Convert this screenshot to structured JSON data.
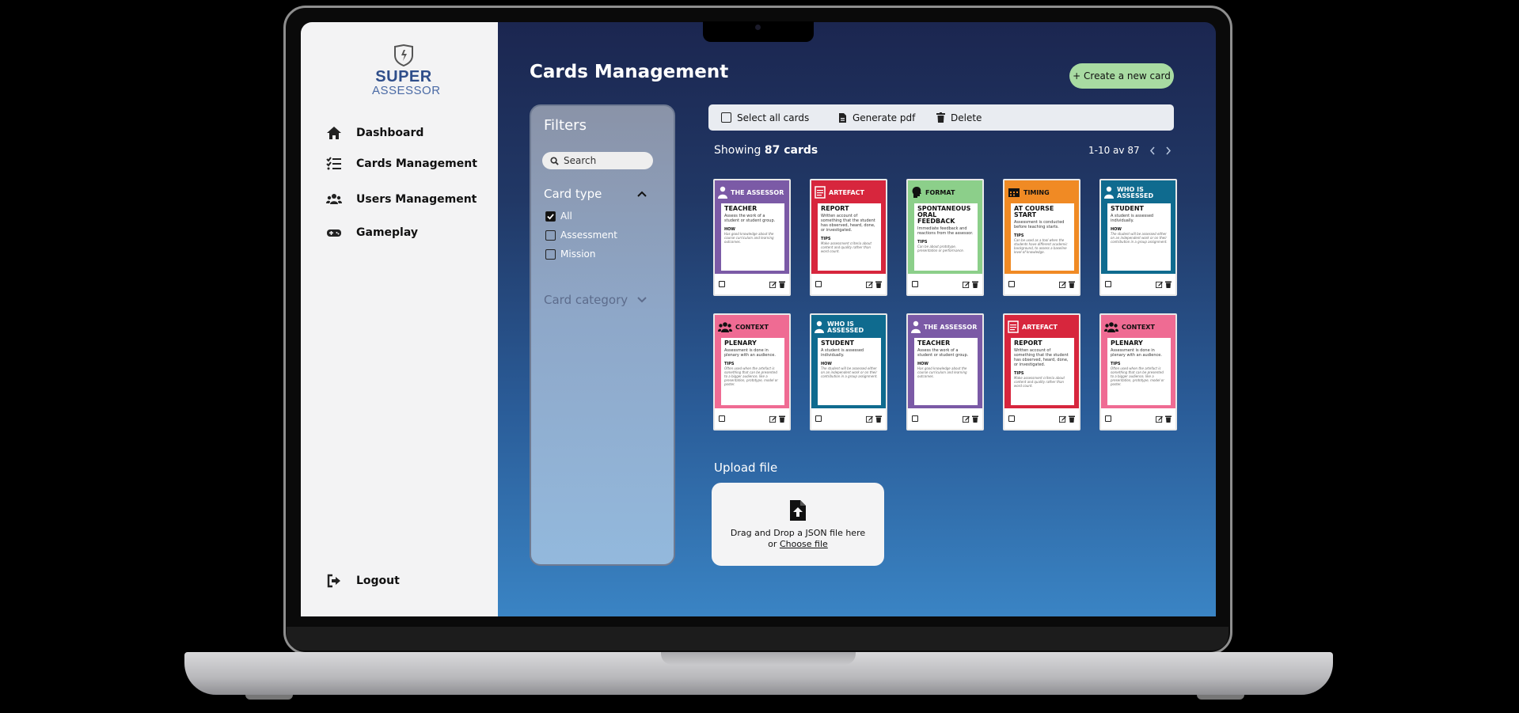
{
  "logo": {
    "word1": "SUPER",
    "word2": "ASSESSOR"
  },
  "sidebar": {
    "items": [
      {
        "label": "Dashboard",
        "icon": "home-icon"
      },
      {
        "label": "Cards Management",
        "icon": "checklist-icon"
      },
      {
        "label": "Users Management",
        "icon": "users-icon"
      },
      {
        "label": "Gameplay",
        "icon": "gamepad-icon"
      }
    ],
    "logout": "Logout"
  },
  "header": {
    "title": "Cards Management",
    "create_label": "+ Create a new card"
  },
  "filters": {
    "title": "Filters",
    "search_placeholder": "Search",
    "card_type": {
      "label": "Card type",
      "options": [
        {
          "label": "All",
          "checked": true
        },
        {
          "label": "Assessment",
          "checked": false
        },
        {
          "label": "Mission",
          "checked": false
        }
      ]
    },
    "card_category": {
      "label": "Card category"
    }
  },
  "toolbar": {
    "select_all": "Select all cards",
    "generate_pdf": "Generate pdf",
    "delete": "Delete"
  },
  "summary": {
    "prefix": "Showing",
    "count": "87 cards",
    "range": "1-10 av 87"
  },
  "cards": [
    {
      "category": "THE ASSESSOR",
      "title": "TEACHER",
      "desc": "Assess the work of a student or student group.",
      "label": "HOW",
      "note": "Has good knowledge about the course curriculum and learning outcomes.",
      "color": "#7b5aa6",
      "icon": "person-icon"
    },
    {
      "category": "ARTEFACT",
      "title": "REPORT",
      "desc": "Written account of something that the student has observed, heard, done, or investigated.",
      "label": "TIPS",
      "note": "Make assessment criteria about content and quality rather than word count.",
      "color": "#d7263d",
      "icon": "document-icon"
    },
    {
      "category": "FORMAT",
      "title": "SPONTANEOUS ORAL FEEDBACK",
      "desc": "Immediate feedback and reactions from the assessor.",
      "label": "TIPS",
      "note": "Can be about prototype, presentation or performance.",
      "color": "#8ccf8a",
      "icon": "speech-head-icon"
    },
    {
      "category": "TIMING",
      "title": "AT COURSE START",
      "desc": "Assessment is conducted before teaching starts.",
      "label": "TIPS",
      "note": "Can be used as a tool when the students have different academic background, to assess a baseline level of knowledge.",
      "color": "#f08a24",
      "icon": "calendar-icon"
    },
    {
      "category": "WHO IS ASSESSED",
      "title": "STUDENT",
      "desc": "A student is assessed individually.",
      "label": "HOW",
      "note": "The student will be assessed either on an independent work or on their contribution in a group assignment.",
      "color": "#0f6b8f",
      "icon": "person-icon"
    },
    {
      "category": "CONTEXT",
      "title": "PLENARY",
      "desc": "Assessment is done in plenary with an audience.",
      "label": "TIPS",
      "note": "Often used when the artefact is something that can be presented to a bigger audience, like a presentation, prototype, model or poster.",
      "color": "#ef6b93",
      "icon": "group-icon"
    },
    {
      "category": "WHO IS ASSESSED",
      "title": "STUDENT",
      "desc": "A student is assessed individually.",
      "label": "HOW",
      "note": "The student will be assessed either on an independent work or on their contribution in a group assignment.",
      "color": "#0f6b8f",
      "icon": "person-icon"
    },
    {
      "category": "THE ASSESSOR",
      "title": "TEACHER",
      "desc": "Assess the work of a student or student group.",
      "label": "HOW",
      "note": "Has good knowledge about the course curriculum and learning outcomes.",
      "color": "#7b5aa6",
      "icon": "person-icon"
    },
    {
      "category": "ARTEFACT",
      "title": "REPORT",
      "desc": "Written account of something that the student has observed, heard, done, or investigated.",
      "label": "TIPS",
      "note": "Make assessment criteria about content and quality rather than word count.",
      "color": "#d7263d",
      "icon": "document-icon"
    },
    {
      "category": "CONTEXT",
      "title": "PLENARY",
      "desc": "Assessment is done in plenary with an audience.",
      "label": "TIPS",
      "note": "Often used when the artefact is something that can be presented to a bigger audience, like a presentation, prototype, model or poster.",
      "color": "#ef6b93",
      "icon": "group-icon"
    }
  ],
  "upload": {
    "label": "Upload file",
    "line1": "Drag and Drop a JSON file here",
    "or": "or",
    "choose": "Choose file"
  }
}
